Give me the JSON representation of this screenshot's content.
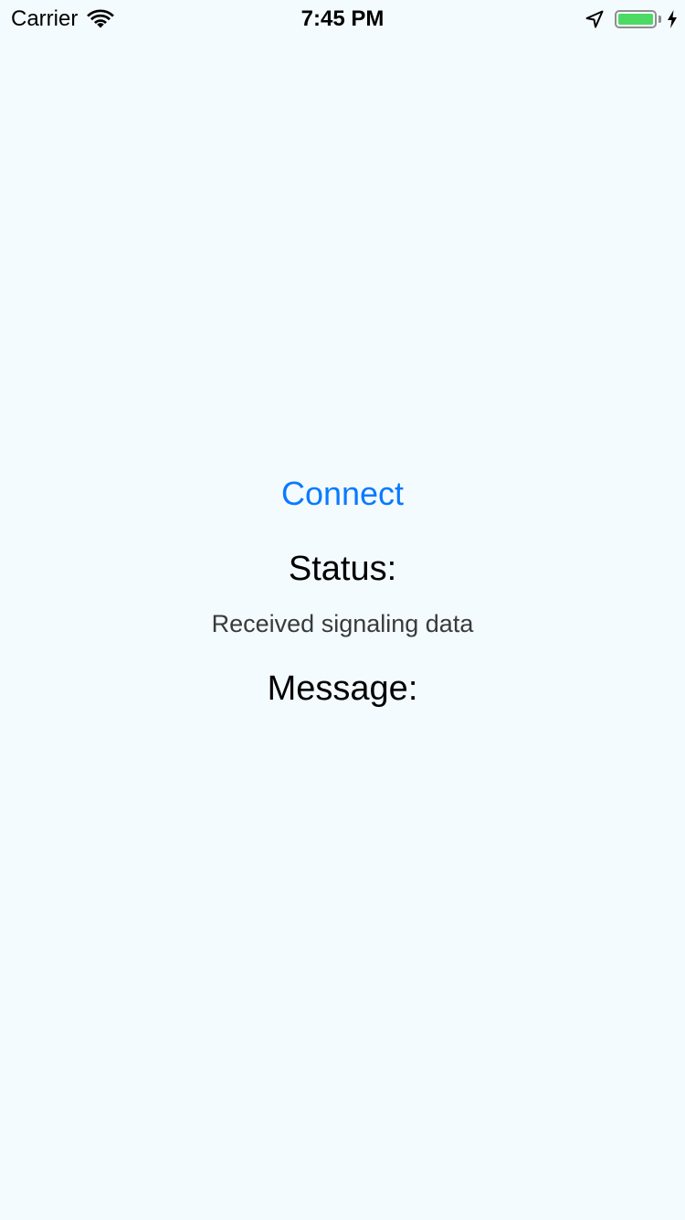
{
  "status_bar": {
    "carrier": "Carrier",
    "time": "7:45 PM",
    "battery_level": 1.0,
    "charging": true,
    "icons": [
      "wifi-icon",
      "location-arrow-icon",
      "battery-icon",
      "charging-bolt-icon"
    ]
  },
  "main": {
    "connect_label": "Connect",
    "status_label": "Status:",
    "status_value": "Received signaling data",
    "message_label": "Message:"
  },
  "colors": {
    "background": "#f4fbfe",
    "accent": "#0a7aff",
    "battery": "#4cd964",
    "secondary_text": "#3a3a3c"
  }
}
